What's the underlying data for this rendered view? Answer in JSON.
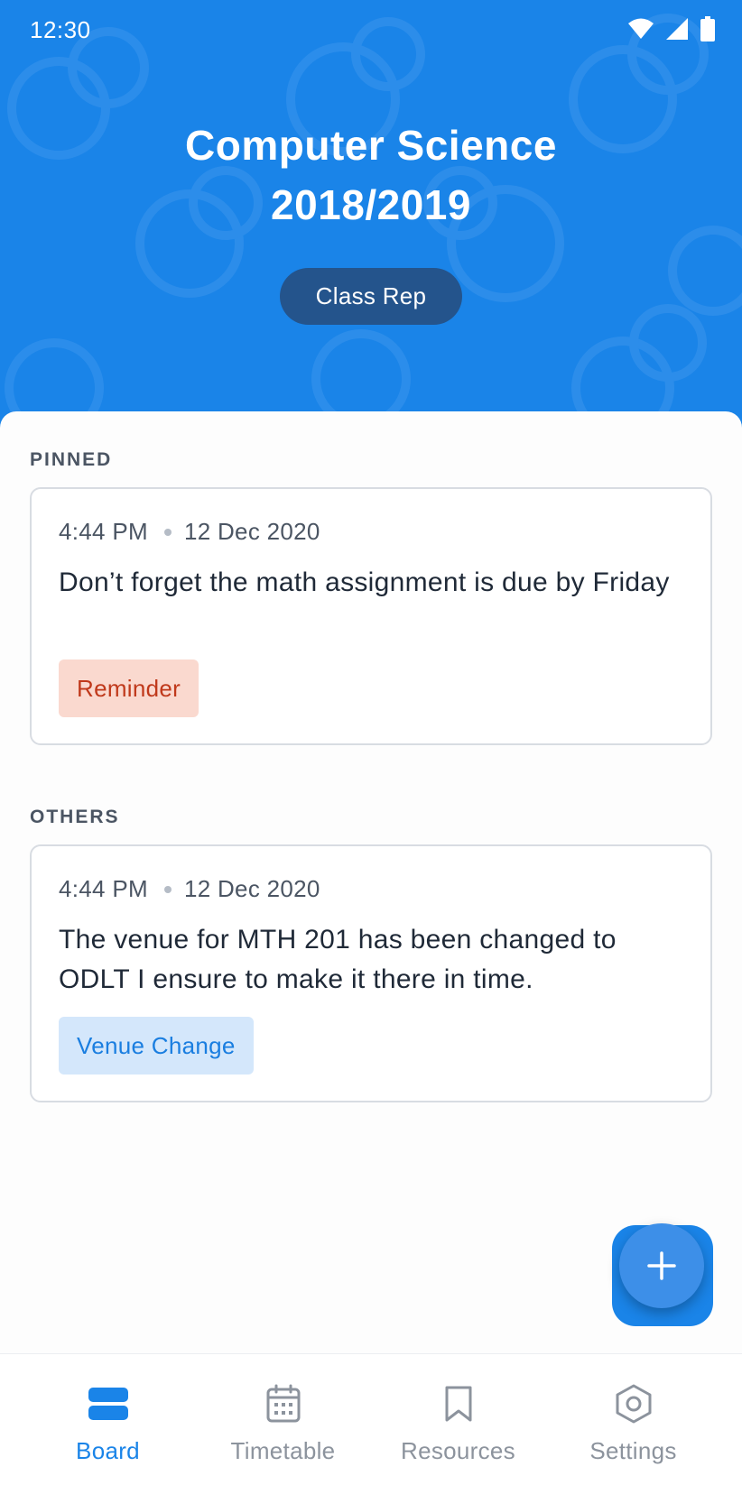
{
  "status_bar": {
    "time": "12:30"
  },
  "header": {
    "title_line1": "Computer Science",
    "title_line2": "2018/2019",
    "role": "Class Rep"
  },
  "sections": {
    "pinned_label": "PINNED",
    "others_label": "OTHERS"
  },
  "posts": [
    {
      "time": "4:44 PM",
      "date": "12 Dec 2020",
      "text": "Don’t forget the math assignment is due by Friday",
      "tag": "Reminder",
      "tag_color": "#c0391b"
    },
    {
      "time": "4:44 PM",
      "date": "12 Dec 2020",
      "text": "The venue for MTH 201 has been changed to ODLT I ensure to make it there in time.",
      "tag": "Venue Change",
      "tag_color": "#1a7ee0"
    }
  ],
  "fab": {
    "icon": "plus-icon"
  },
  "nav": {
    "active": "board",
    "items": [
      {
        "label": "Board",
        "icon": "board-icon"
      },
      {
        "label": "Timetable",
        "icon": "calendar-icon"
      },
      {
        "label": "Resources",
        "icon": "bookmark-icon"
      },
      {
        "label": "Settings",
        "icon": "gear-icon"
      }
    ]
  },
  "colors": {
    "brand": "#1a84e8",
    "pill": "#24548c",
    "text": "#1f2937",
    "muted": "#8c939d"
  }
}
